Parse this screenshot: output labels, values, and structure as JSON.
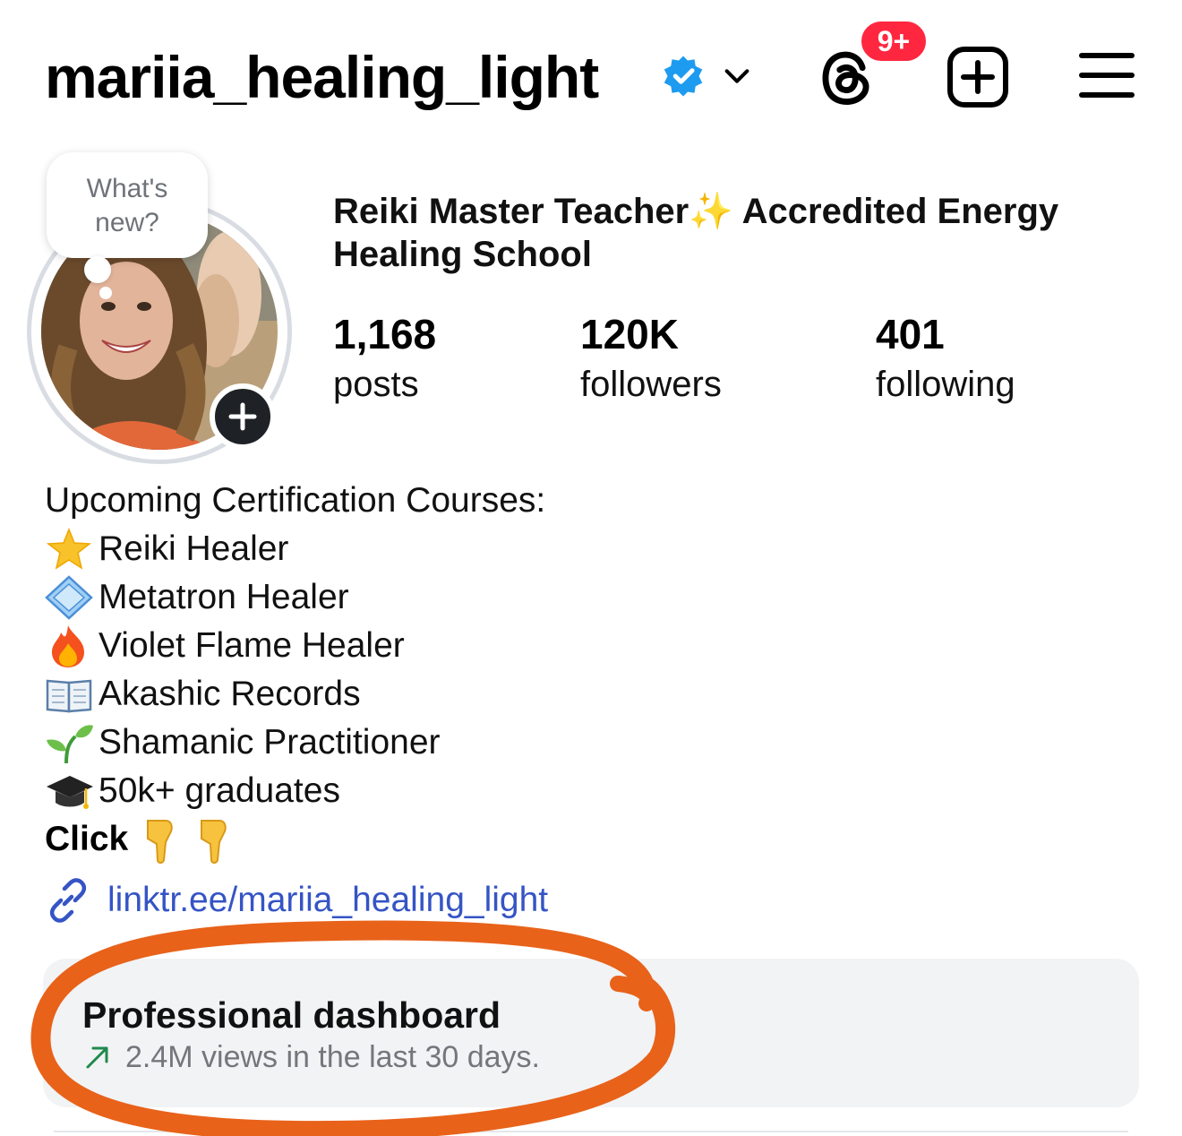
{
  "header": {
    "username": "mariia_healing_light",
    "threads_badge": "9+",
    "icons": [
      "verified-badge-icon",
      "chevron-down-icon",
      "threads-icon",
      "create-plus-icon",
      "menu-icon"
    ]
  },
  "profile": {
    "note": "What's new?",
    "title": "Reiki Master Teacher✨ Accredited Energy Healing School",
    "stats": {
      "posts": {
        "value": "1,168",
        "label": "posts"
      },
      "followers": {
        "value": "120K",
        "label": "followers"
      },
      "following": {
        "value": "401",
        "label": "following"
      }
    }
  },
  "bio": {
    "heading": "Upcoming Certification Courses:",
    "items": [
      {
        "icon": "glowing-star-icon",
        "text": "Reiki Healer"
      },
      {
        "icon": "diamond-shape-icon",
        "text": "Metatron Healer"
      },
      {
        "icon": "fire-icon",
        "text": "Violet Flame Healer"
      },
      {
        "icon": "open-book-icon",
        "text": "Akashic Records"
      },
      {
        "icon": "seedling-icon",
        "text": "Shamanic Practitioner"
      },
      {
        "icon": "graduation-cap-icon",
        "text": "50k+ graduates"
      }
    ],
    "click": "Click",
    "link": "linktr.ee/mariia_healing_light"
  },
  "dashboard": {
    "title": "Professional dashboard",
    "subtitle": "2.4M views in the last 30 days."
  },
  "colors": {
    "accent_link": "#3554c5",
    "verified": "#1d9bf0",
    "badge": "#ff2740",
    "highlight_circle": "#e8621a",
    "trend_arrow": "#1f8a4c"
  }
}
